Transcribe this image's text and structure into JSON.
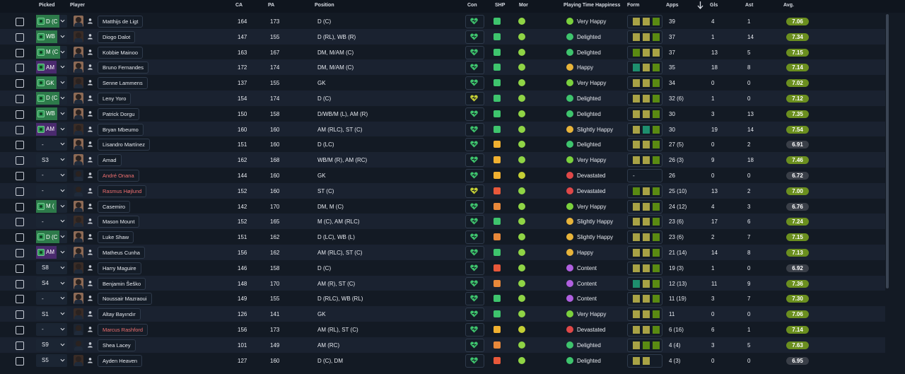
{
  "headers": {
    "picked": "Picked",
    "player": "Player",
    "ca": "CA",
    "pa": "PA",
    "position": "Position",
    "con": "Con",
    "shp": "SHP",
    "mor": "Mor",
    "pth": "Playing Time Happiness",
    "form": "Form",
    "apps": "Apps",
    "gls": "Gls",
    "ast": "Ast",
    "avg": "Avg."
  },
  "colors": {
    "good": "#3ec46d",
    "avg_green": "#6b8f1f",
    "avg_dark": "#3a3f48",
    "pick_green": "#2d7a4a",
    "pick_purple": "#4a2a6e",
    "name_red": "#f07070"
  },
  "players": [
    {
      "pick_type": "pos",
      "pick": "D (C",
      "pick_color": "g",
      "name": "Matthijs de Ligt",
      "ca": "164",
      "pa": "173",
      "position": "D (C)",
      "con": "green",
      "shp": "ok",
      "mor": "g",
      "happy": "Very Happy",
      "happy_color": "#7bd13d",
      "form": [
        "y",
        "y",
        "g"
      ],
      "apps": "39",
      "gls": "4",
      "ast": "1",
      "avg": "7.06",
      "avg_type": "gr"
    },
    {
      "pick_type": "pos",
      "pick": "WB",
      "pick_color": "g",
      "name": "Diogo Dalot",
      "ca": "147",
      "pa": "155",
      "position": "D (RL), WB (R)",
      "con": "green",
      "shp": "ok",
      "mor": "g",
      "happy": "Delighted",
      "happy_color": "#3ec46d",
      "form": [
        "y",
        "y",
        "g"
      ],
      "apps": "37",
      "gls": "1",
      "ast": "14",
      "avg": "7.34",
      "avg_type": "gr"
    },
    {
      "pick_type": "pos",
      "pick": "M (C",
      "pick_color": "g",
      "name": "Kobbie Mainoo",
      "ca": "163",
      "pa": "167",
      "position": "DM, M/AM (C)",
      "con": "green",
      "shp": "ok",
      "mor": "g",
      "happy": "Delighted",
      "happy_color": "#3ec46d",
      "form": [
        "g",
        "y",
        "y"
      ],
      "apps": "37",
      "gls": "13",
      "ast": "5",
      "avg": "7.15",
      "avg_type": "gr"
    },
    {
      "pick_type": "pos",
      "pick": "AM",
      "pick_color": "p",
      "name": "Bruno Fernandes",
      "ca": "172",
      "pa": "174",
      "position": "DM, M/AM (C)",
      "con": "green",
      "shp": "ok",
      "mor": "g",
      "happy": "Happy",
      "happy_color": "#e8b43a",
      "form": [
        "t",
        "y",
        "g"
      ],
      "apps": "35",
      "gls": "18",
      "ast": "8",
      "avg": "7.14",
      "avg_type": "gr"
    },
    {
      "pick_type": "pos",
      "pick": "GK",
      "pick_color": "g",
      "name": "Senne Lammens",
      "ca": "137",
      "pa": "155",
      "position": "GK",
      "con": "green",
      "shp": "ok",
      "mor": "g",
      "happy": "Very Happy",
      "happy_color": "#7bd13d",
      "form": [
        "y",
        "y",
        "g"
      ],
      "apps": "34",
      "gls": "0",
      "ast": "0",
      "avg": "7.02",
      "avg_type": "gr"
    },
    {
      "pick_type": "pos",
      "pick": "D (C",
      "pick_color": "g",
      "name": "Leny Yoro",
      "ca": "154",
      "pa": "174",
      "position": "D (C)",
      "con": "yellow",
      "shp": "ok",
      "mor": "g",
      "happy": "Delighted",
      "happy_color": "#3ec46d",
      "form": [
        "y",
        "y",
        "g"
      ],
      "apps": "32 (6)",
      "gls": "1",
      "ast": "0",
      "avg": "7.12",
      "avg_type": "gr"
    },
    {
      "pick_type": "pos",
      "pick": "WB",
      "pick_color": "g",
      "name": "Patrick Dorgu",
      "ca": "150",
      "pa": "158",
      "position": "D/WB/M (L), AM (R)",
      "con": "green",
      "shp": "ok",
      "mor": "g",
      "happy": "Delighted",
      "happy_color": "#3ec46d",
      "form": [
        "y",
        "y",
        "g"
      ],
      "apps": "30",
      "gls": "3",
      "ast": "13",
      "avg": "7.35",
      "avg_type": "gr"
    },
    {
      "pick_type": "pos",
      "pick": "AM",
      "pick_color": "p",
      "name": "Bryan Mbeumo",
      "ca": "160",
      "pa": "160",
      "position": "AM (RLC), ST (C)",
      "con": "green",
      "shp": "ok",
      "mor": "g",
      "happy": "Slightly Happy",
      "happy_color": "#e8b43a",
      "form": [
        "y",
        "t",
        "g"
      ],
      "apps": "30",
      "gls": "19",
      "ast": "14",
      "avg": "7.54",
      "avg_type": "gr"
    },
    {
      "pick_type": "text",
      "pick": "-",
      "name": "Lisandro Martínez",
      "ca": "151",
      "pa": "160",
      "position": "D (LC)",
      "con": "green",
      "shp": "mid",
      "mor": "g",
      "happy": "Delighted",
      "happy_color": "#3ec46d",
      "form": [
        "y",
        "y",
        "g"
      ],
      "apps": "27 (5)",
      "gls": "0",
      "ast": "2",
      "avg": "6.91",
      "avg_type": "dk"
    },
    {
      "pick_type": "text",
      "pick": "S3",
      "name": "Amad",
      "ca": "162",
      "pa": "168",
      "position": "WB/M (R), AM (RC)",
      "con": "green",
      "shp": "mid",
      "mor": "g",
      "happy": "Very Happy",
      "happy_color": "#7bd13d",
      "form": [
        "y",
        "y",
        "g"
      ],
      "apps": "26 (3)",
      "gls": "9",
      "ast": "18",
      "avg": "7.46",
      "avg_type": "gr"
    },
    {
      "pick_type": "text",
      "pick": "-",
      "name": "André Onana",
      "red": true,
      "ca": "144",
      "pa": "160",
      "position": "GK",
      "con": "green",
      "shp": "mid",
      "mor": "y",
      "happy": "Devastated",
      "happy_color": "#e04848",
      "form": "-",
      "apps": "26",
      "gls": "0",
      "ast": "0",
      "avg": "6.72",
      "avg_type": "dk"
    },
    {
      "pick_type": "text",
      "pick": "-",
      "name": "Rasmus Højlund",
      "red": true,
      "ca": "152",
      "pa": "160",
      "position": "ST (C)",
      "con": "yellow",
      "shp": "bad",
      "mor": "g",
      "happy": "Devastated",
      "happy_color": "#e04848",
      "form": [
        "g",
        "y",
        "g"
      ],
      "apps": "25 (10)",
      "gls": "13",
      "ast": "2",
      "avg": "7.00",
      "avg_type": "gr"
    },
    {
      "pick_type": "pos",
      "pick": "M (",
      "pick_color": "g",
      "name": "Casemiro",
      "ca": "142",
      "pa": "170",
      "position": "DM, M (C)",
      "con": "green",
      "shp": "warn",
      "mor": "g",
      "happy": "Very Happy",
      "happy_color": "#7bd13d",
      "form": [
        "y",
        "y",
        "g"
      ],
      "apps": "24 (12)",
      "gls": "4",
      "ast": "3",
      "avg": "6.76",
      "avg_type": "dk"
    },
    {
      "pick_type": "text",
      "pick": "-",
      "name": "Mason Mount",
      "ca": "152",
      "pa": "165",
      "position": "M (C), AM (RLC)",
      "con": "green",
      "shp": "ok",
      "mor": "g",
      "happy": "Slightly Happy",
      "happy_color": "#e8b43a",
      "form": [
        "y",
        "y",
        "g"
      ],
      "apps": "23 (6)",
      "gls": "17",
      "ast": "6",
      "avg": "7.24",
      "avg_type": "gr"
    },
    {
      "pick_type": "pos",
      "pick": "D (C",
      "pick_color": "g",
      "name": "Luke Shaw",
      "ca": "151",
      "pa": "162",
      "position": "D (LC), WB (L)",
      "con": "green",
      "shp": "warn",
      "mor": "g",
      "happy": "Slightly Happy",
      "happy_color": "#e8b43a",
      "form": [
        "y",
        "y",
        "g"
      ],
      "apps": "23 (6)",
      "gls": "2",
      "ast": "7",
      "avg": "7.15",
      "avg_type": "gr"
    },
    {
      "pick_type": "pos",
      "pick": "AM",
      "pick_color": "p",
      "name": "Matheus Cunha",
      "ca": "156",
      "pa": "162",
      "position": "AM (RLC), ST (C)",
      "con": "green",
      "shp": "ok",
      "mor": "g",
      "happy": "Happy",
      "happy_color": "#e8b43a",
      "form": [
        "y",
        "y",
        "g"
      ],
      "apps": "21 (14)",
      "gls": "14",
      "ast": "8",
      "avg": "7.13",
      "avg_type": "gr"
    },
    {
      "pick_type": "text",
      "pick": "S8",
      "name": "Harry Maguire",
      "ca": "146",
      "pa": "158",
      "position": "D (C)",
      "con": "green",
      "shp": "bad",
      "mor": "g",
      "happy": "Content",
      "happy_color": "#b060e0",
      "form": [
        "y",
        "y",
        "g"
      ],
      "apps": "19 (3)",
      "gls": "1",
      "ast": "0",
      "avg": "6.92",
      "avg_type": "dk"
    },
    {
      "pick_type": "text",
      "pick": "S4",
      "name": "Benjamin Šeško",
      "ca": "148",
      "pa": "170",
      "position": "AM (R), ST (C)",
      "con": "green",
      "shp": "warn",
      "mor": "g",
      "happy": "Content",
      "happy_color": "#b060e0",
      "form": [
        "t",
        "y",
        "g"
      ],
      "apps": "12 (13)",
      "gls": "11",
      "ast": "9",
      "avg": "7.36",
      "avg_type": "gr"
    },
    {
      "pick_type": "text",
      "pick": "-",
      "name": "Noussair Mazraoui",
      "ca": "149",
      "pa": "155",
      "position": "D (RLC), WB (RL)",
      "con": "green",
      "shp": "ok",
      "mor": "g",
      "happy": "Content",
      "happy_color": "#b060e0",
      "form": [
        "y",
        "y",
        "g"
      ],
      "apps": "11 (19)",
      "gls": "3",
      "ast": "7",
      "avg": "7.30",
      "avg_type": "gr"
    },
    {
      "pick_type": "text",
      "pick": "S1",
      "name": "Altay Bayındır",
      "ca": "126",
      "pa": "141",
      "position": "GK",
      "con": "green",
      "shp": "ok",
      "mor": "g",
      "happy": "Very Happy",
      "happy_color": "#7bd13d",
      "form": [
        "y",
        "y",
        "g"
      ],
      "apps": "11",
      "gls": "0",
      "ast": "0",
      "avg": "7.06",
      "avg_type": "gr"
    },
    {
      "pick_type": "text",
      "pick": "-",
      "name": "Marcus Rashford",
      "red": true,
      "ca": "156",
      "pa": "173",
      "position": "AM (RL), ST (C)",
      "con": "green",
      "shp": "mid",
      "mor": "y",
      "happy": "Devastated",
      "happy_color": "#e04848",
      "form": [
        "y",
        "y",
        "g"
      ],
      "apps": "6 (16)",
      "gls": "6",
      "ast": "1",
      "avg": "7.14",
      "avg_type": "gr"
    },
    {
      "pick_type": "text",
      "pick": "S9",
      "name": "Shea Lacey",
      "ca": "101",
      "pa": "149",
      "position": "AM (RC)",
      "con": "green",
      "shp": "warn",
      "mor": "g",
      "happy": "Delighted",
      "happy_color": "#3ec46d",
      "form": [
        "y",
        "g",
        "g"
      ],
      "apps": "4 (4)",
      "gls": "3",
      "ast": "5",
      "avg": "7.63",
      "avg_type": "gr"
    },
    {
      "pick_type": "text",
      "pick": "S5",
      "name": "Ayden Heaven",
      "ca": "127",
      "pa": "160",
      "position": "D (C), DM",
      "con": "green",
      "shp": "bad",
      "mor": "g",
      "happy": "Delighted",
      "happy_color": "#3ec46d",
      "form": [
        "y",
        "y"
      ],
      "apps": "4 (3)",
      "gls": "0",
      "ast": "0",
      "avg": "6.95",
      "avg_type": "dk"
    }
  ]
}
